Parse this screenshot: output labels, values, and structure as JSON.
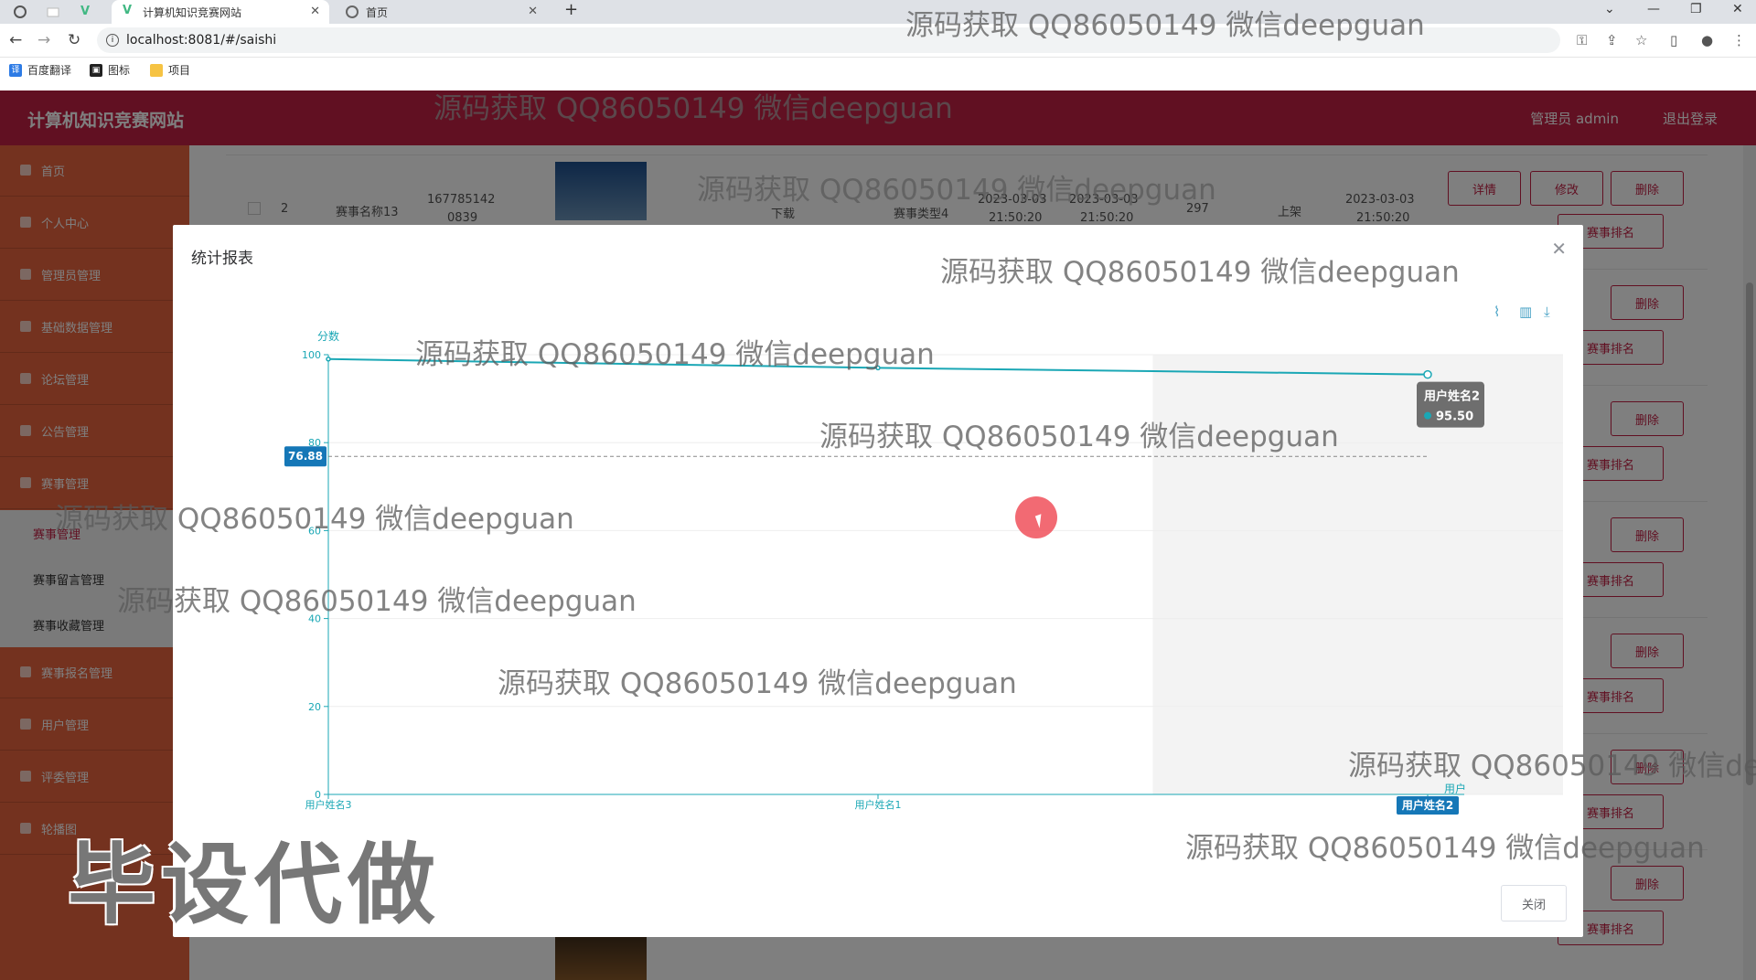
{
  "browser": {
    "tabs": [
      {
        "label": "计算机知识竞赛网站",
        "active": true
      },
      {
        "label": "首页",
        "active": false
      }
    ],
    "url": "localhost:8081/#/saishi",
    "bookmarks": [
      "百度翻译",
      "图标",
      "项目"
    ]
  },
  "app": {
    "title": "计算机知识竞赛网站",
    "user_label": "管理员 admin",
    "logout_label": "退出登录",
    "brand_color": "#c22045",
    "sidebar_color": "#e8643f"
  },
  "sidebar": {
    "items": [
      "首页",
      "个人中心",
      "管理员管理",
      "基础数据管理",
      "论坛管理",
      "公告管理",
      "赛事管理",
      "赛事报名管理",
      "用户管理",
      "评委管理",
      "轮播图"
    ],
    "sub_items": [
      "赛事管理",
      "赛事留言管理",
      "赛事收藏管理"
    ]
  },
  "table": {
    "row": {
      "index": "2",
      "name": "赛事名称13",
      "id_line1": "167785142",
      "id_line2": "0839",
      "file": "下载",
      "type": "赛事类型4",
      "start_date": "2023-03-03",
      "start_time": "21:50:20",
      "end_date": "2023-03-03",
      "end_time": "21:50:20",
      "count": "297",
      "status": "上架",
      "created_date": "2023-03-03",
      "created_time": "21:50:20"
    },
    "actions": {
      "detail": "详情",
      "edit": "修改",
      "delete": "删除",
      "rank": "赛事排名"
    }
  },
  "dialog": {
    "title": "统计报表",
    "close_label": "关闭",
    "toolbox": [
      "line-chart-icon",
      "bar-chart-icon",
      "download-icon"
    ]
  },
  "chart_data": {
    "type": "line",
    "ylabel": "分数",
    "xlabel": "用户",
    "categories": [
      "用户姓名3",
      "用户姓名1",
      "用户姓名2"
    ],
    "series": [
      {
        "values": [
          99,
          97,
          95.5
        ]
      }
    ],
    "ylim": [
      0,
      100
    ],
    "yticks": [
      0,
      20,
      40,
      60,
      80,
      100
    ],
    "average_marker": 76.88,
    "tooltip": {
      "category": "用户姓名2",
      "value": "95.50"
    },
    "highlighted_category": "用户姓名2",
    "line_color": "#1aa7b5"
  },
  "overlay": {
    "watermark": "源码获取 QQ86050149 微信deepguan",
    "big_watermark": "毕设代做"
  }
}
